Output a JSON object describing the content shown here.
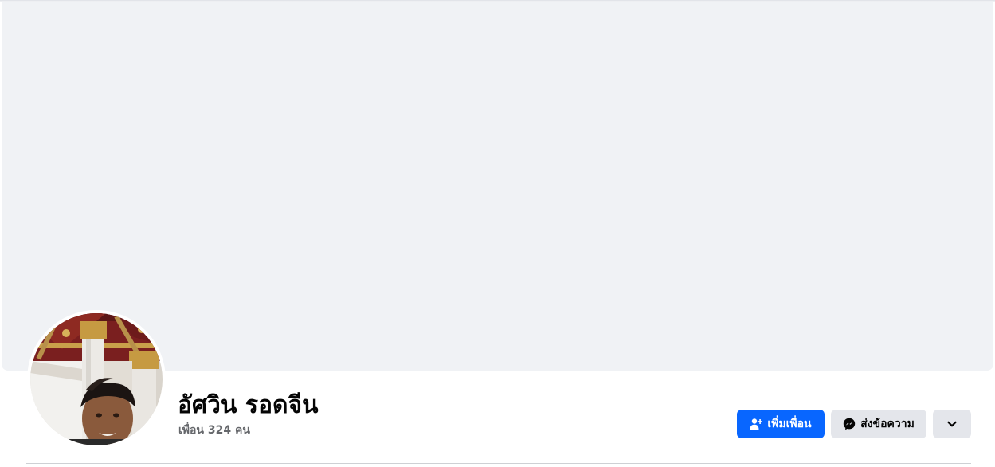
{
  "profile": {
    "name": "อัศวิน รอดจีน",
    "friends_count": "เพื่อน 324 คน"
  },
  "actions": {
    "add_friend_label": "เพิ่มเพื่อน",
    "message_label": "ส่งข้อความ"
  },
  "icons": {
    "add_friend": "add-friend-icon",
    "messenger": "messenger-icon",
    "more": "chevron-down-icon"
  },
  "colors": {
    "primary_button": "#0866ff",
    "secondary_button": "#e4e6eb",
    "cover_background": "#f0f2f5",
    "secondary_text": "#65676b"
  }
}
